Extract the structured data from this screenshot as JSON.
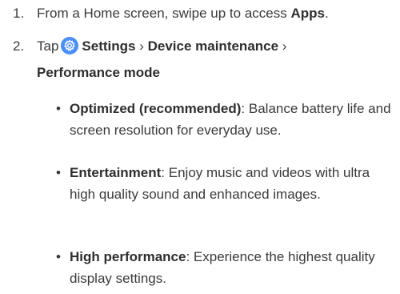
{
  "steps": [
    {
      "number": "1.",
      "text_before": "From a Home screen, swipe up to access ",
      "bold": "Apps",
      "text_after": "."
    },
    {
      "number": "2.",
      "tap_label": "Tap",
      "icon": "settings-gear-icon",
      "path_1": "Settings",
      "sep_1": " › ",
      "path_2": "Device maintenance",
      "sep_2": " ›",
      "path_3": "Performance mode"
    }
  ],
  "options": [
    {
      "name": "Optimized (recommended)",
      "description": ": Balance battery life and screen resolution for everyday use."
    },
    {
      "name": "Entertainment",
      "description": ": Enjoy music and videos with ultra high quality sound and enhanced images."
    },
    {
      "name": "High performance",
      "description": ": Experience the highest quality display settings."
    }
  ],
  "colors": {
    "text": "#3a3a3a",
    "icon_background": "#4a8ef7"
  }
}
